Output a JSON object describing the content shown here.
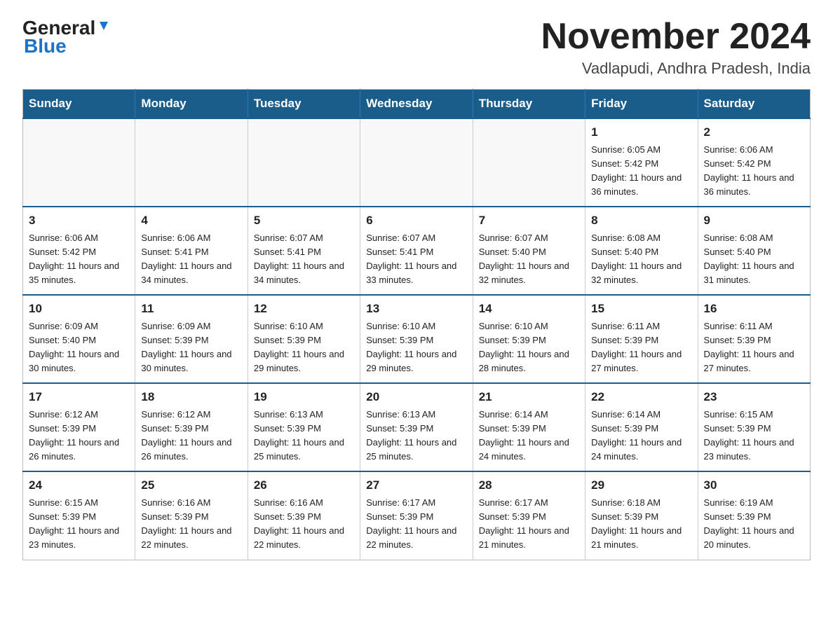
{
  "logo": {
    "general": "General",
    "triangle": "▶",
    "blue": "Blue"
  },
  "title": "November 2024",
  "subtitle": "Vadlapudi, Andhra Pradesh, India",
  "weekdays": [
    "Sunday",
    "Monday",
    "Tuesday",
    "Wednesday",
    "Thursday",
    "Friday",
    "Saturday"
  ],
  "weeks": [
    [
      {
        "day": "",
        "info": ""
      },
      {
        "day": "",
        "info": ""
      },
      {
        "day": "",
        "info": ""
      },
      {
        "day": "",
        "info": ""
      },
      {
        "day": "",
        "info": ""
      },
      {
        "day": "1",
        "info": "Sunrise: 6:05 AM\nSunset: 5:42 PM\nDaylight: 11 hours and 36 minutes."
      },
      {
        "day": "2",
        "info": "Sunrise: 6:06 AM\nSunset: 5:42 PM\nDaylight: 11 hours and 36 minutes."
      }
    ],
    [
      {
        "day": "3",
        "info": "Sunrise: 6:06 AM\nSunset: 5:42 PM\nDaylight: 11 hours and 35 minutes."
      },
      {
        "day": "4",
        "info": "Sunrise: 6:06 AM\nSunset: 5:41 PM\nDaylight: 11 hours and 34 minutes."
      },
      {
        "day": "5",
        "info": "Sunrise: 6:07 AM\nSunset: 5:41 PM\nDaylight: 11 hours and 34 minutes."
      },
      {
        "day": "6",
        "info": "Sunrise: 6:07 AM\nSunset: 5:41 PM\nDaylight: 11 hours and 33 minutes."
      },
      {
        "day": "7",
        "info": "Sunrise: 6:07 AM\nSunset: 5:40 PM\nDaylight: 11 hours and 32 minutes."
      },
      {
        "day": "8",
        "info": "Sunrise: 6:08 AM\nSunset: 5:40 PM\nDaylight: 11 hours and 32 minutes."
      },
      {
        "day": "9",
        "info": "Sunrise: 6:08 AM\nSunset: 5:40 PM\nDaylight: 11 hours and 31 minutes."
      }
    ],
    [
      {
        "day": "10",
        "info": "Sunrise: 6:09 AM\nSunset: 5:40 PM\nDaylight: 11 hours and 30 minutes."
      },
      {
        "day": "11",
        "info": "Sunrise: 6:09 AM\nSunset: 5:39 PM\nDaylight: 11 hours and 30 minutes."
      },
      {
        "day": "12",
        "info": "Sunrise: 6:10 AM\nSunset: 5:39 PM\nDaylight: 11 hours and 29 minutes."
      },
      {
        "day": "13",
        "info": "Sunrise: 6:10 AM\nSunset: 5:39 PM\nDaylight: 11 hours and 29 minutes."
      },
      {
        "day": "14",
        "info": "Sunrise: 6:10 AM\nSunset: 5:39 PM\nDaylight: 11 hours and 28 minutes."
      },
      {
        "day": "15",
        "info": "Sunrise: 6:11 AM\nSunset: 5:39 PM\nDaylight: 11 hours and 27 minutes."
      },
      {
        "day": "16",
        "info": "Sunrise: 6:11 AM\nSunset: 5:39 PM\nDaylight: 11 hours and 27 minutes."
      }
    ],
    [
      {
        "day": "17",
        "info": "Sunrise: 6:12 AM\nSunset: 5:39 PM\nDaylight: 11 hours and 26 minutes."
      },
      {
        "day": "18",
        "info": "Sunrise: 6:12 AM\nSunset: 5:39 PM\nDaylight: 11 hours and 26 minutes."
      },
      {
        "day": "19",
        "info": "Sunrise: 6:13 AM\nSunset: 5:39 PM\nDaylight: 11 hours and 25 minutes."
      },
      {
        "day": "20",
        "info": "Sunrise: 6:13 AM\nSunset: 5:39 PM\nDaylight: 11 hours and 25 minutes."
      },
      {
        "day": "21",
        "info": "Sunrise: 6:14 AM\nSunset: 5:39 PM\nDaylight: 11 hours and 24 minutes."
      },
      {
        "day": "22",
        "info": "Sunrise: 6:14 AM\nSunset: 5:39 PM\nDaylight: 11 hours and 24 minutes."
      },
      {
        "day": "23",
        "info": "Sunrise: 6:15 AM\nSunset: 5:39 PM\nDaylight: 11 hours and 23 minutes."
      }
    ],
    [
      {
        "day": "24",
        "info": "Sunrise: 6:15 AM\nSunset: 5:39 PM\nDaylight: 11 hours and 23 minutes."
      },
      {
        "day": "25",
        "info": "Sunrise: 6:16 AM\nSunset: 5:39 PM\nDaylight: 11 hours and 22 minutes."
      },
      {
        "day": "26",
        "info": "Sunrise: 6:16 AM\nSunset: 5:39 PM\nDaylight: 11 hours and 22 minutes."
      },
      {
        "day": "27",
        "info": "Sunrise: 6:17 AM\nSunset: 5:39 PM\nDaylight: 11 hours and 22 minutes."
      },
      {
        "day": "28",
        "info": "Sunrise: 6:17 AM\nSunset: 5:39 PM\nDaylight: 11 hours and 21 minutes."
      },
      {
        "day": "29",
        "info": "Sunrise: 6:18 AM\nSunset: 5:39 PM\nDaylight: 11 hours and 21 minutes."
      },
      {
        "day": "30",
        "info": "Sunrise: 6:19 AM\nSunset: 5:39 PM\nDaylight: 11 hours and 20 minutes."
      }
    ]
  ],
  "colors": {
    "header_bg": "#1a5c8a",
    "header_text": "#ffffff",
    "border": "#1a5c8a",
    "cell_border": "#cccccc"
  }
}
